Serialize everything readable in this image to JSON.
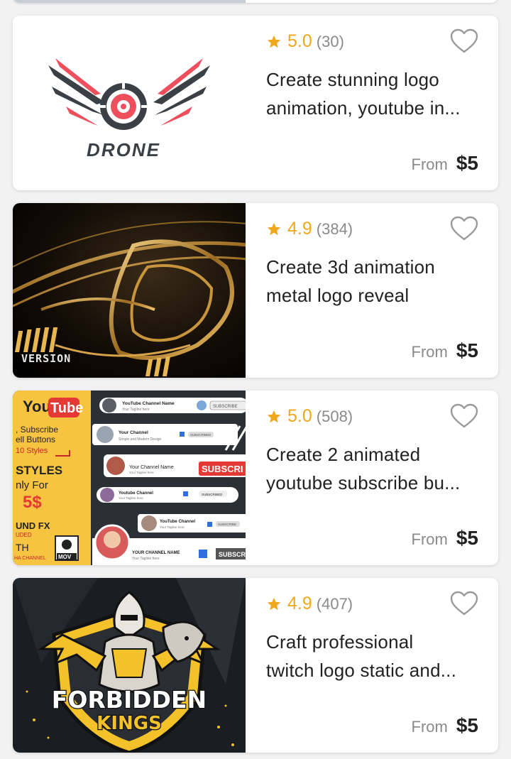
{
  "gigs": [
    {
      "rating": "5.0",
      "reviews": "(30)",
      "title_line1": "Create stunning logo",
      "title_line2": "animation, youtube in...",
      "from_label": "From",
      "price": "$5",
      "thumb_text": "DRONE"
    },
    {
      "rating": "4.9",
      "reviews": "(384)",
      "title_line1": "Create 3d animation",
      "title_line2": "metal logo reveal",
      "from_label": "From",
      "price": "$5",
      "thumb_text": "VERSION"
    },
    {
      "rating": "5.0",
      "reviews": "(508)",
      "title_line1": "Create 2 animated",
      "title_line2": "youtube subscribe bu...",
      "from_label": "From",
      "price": "$5",
      "thumb_text": {
        "brand_you": "You",
        "brand_tube": "Tube",
        "line1": ", Subscribe",
        "line2": "ell Buttons",
        "line3": "10 Styles",
        "line4": "STYLES",
        "line5": "nly For",
        "price": "5$",
        "line6": "UND FX",
        "line7": "UDED",
        "line8": "TH",
        "line9": "HA CHANNEL",
        "mov": "MOV",
        "channel1": "YouTube Channel Name",
        "tag1": "Your Tagline here",
        "sub1": "SUBSCRIBE",
        "channel2": "Your Channel",
        "tag2": "Simple and Modern Design",
        "sub2": "SUBSCRIBED",
        "channel3": "Your Channel Name",
        "tag3": "Your Tagline here",
        "sub3": "SUBSCRI",
        "channel4": "Youtube Channel",
        "tag4": "Your Tagline here",
        "sub4": "SUBSCRIBED",
        "channel5": "YouTube Channel",
        "tag5": "Your Tagline here",
        "sub5": "SUBSCRIBE",
        "channel6": "YOUR CHANNEL NAME",
        "tag6": "Your Tagline here",
        "sub6": "SUBSCR"
      }
    },
    {
      "rating": "4.9",
      "reviews": "(407)",
      "title_line1": "Craft professional",
      "title_line2": "twitch logo static and...",
      "from_label": "From",
      "price": "$5",
      "thumb_text_1": "FORBIDDEN",
      "thumb_text_2": "KINGS"
    }
  ],
  "colors": {
    "star": "#f0a81a",
    "muted": "#8a8a8a",
    "text": "#222222",
    "background": "#f2f2f2"
  },
  "icons": [
    "star-icon",
    "heart-outline-icon"
  ]
}
